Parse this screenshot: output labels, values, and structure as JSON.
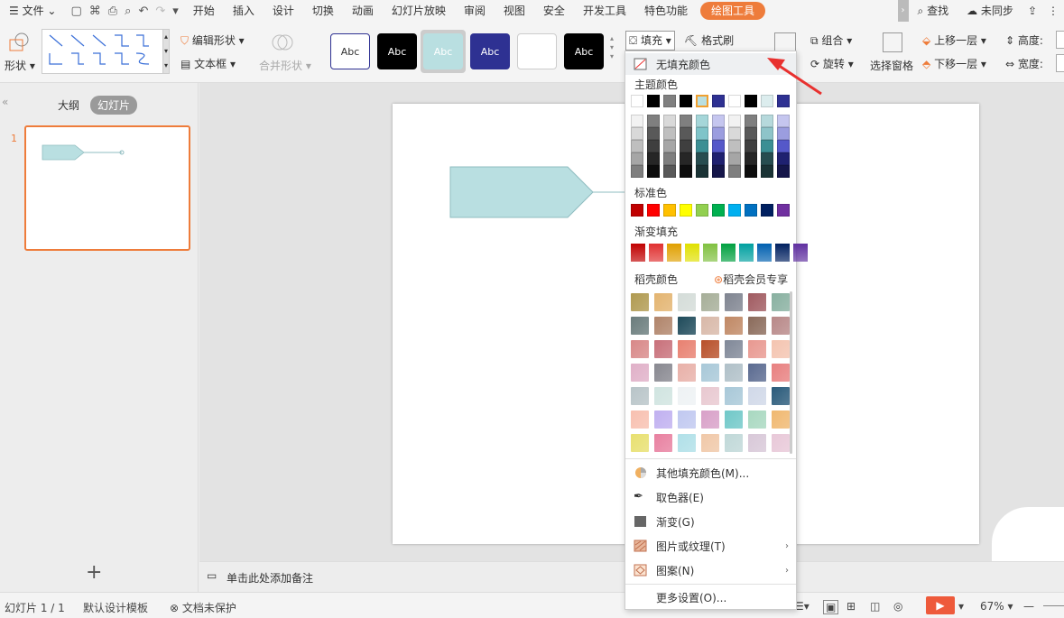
{
  "menubar": {
    "file": "文件",
    "tabs": [
      "开始",
      "插入",
      "设计",
      "切换",
      "动画",
      "幻灯片放映",
      "审阅",
      "视图",
      "安全",
      "开发工具",
      "特色功能"
    ],
    "active_tab": "绘图工具",
    "search": "查找",
    "sync": "未同步"
  },
  "ribbon": {
    "shape": "形状",
    "edit_shape": "编辑形状",
    "text_box": "文本框",
    "merge_shape": "合并形状",
    "style_label": "Abc",
    "fill": "填充",
    "format_painter": "格式刷",
    "group": "组合",
    "rotate": "旋转",
    "selection_pane": "选择窗格",
    "bring_forward": "上移一层",
    "send_backward": "下移一层",
    "height": "高度:",
    "width": "宽度:"
  },
  "panel": {
    "outline_tab": "大纲",
    "slides_tab": "幻灯片",
    "slide_number": "1",
    "add": "+"
  },
  "notes": {
    "placeholder": "单击此处添加备注"
  },
  "status": {
    "slide_count": "幻灯片 1 / 1",
    "template": "默认设计模板",
    "protection": "文档未保护",
    "zoom": "67%"
  },
  "dropdown": {
    "no_fill": "无填充颜色",
    "theme_colors": "主题颜色",
    "standard_colors": "标准色",
    "gradient_fill": "渐变填充",
    "docer_colors": "稻壳颜色",
    "member_exclusive": "稻壳会员专享",
    "more_colors": "其他填充颜色(M)...",
    "eyedropper": "取色器(E)",
    "gradient": "渐变(G)",
    "picture_texture": "图片或纹理(T)",
    "pattern": "图案(N)",
    "more_settings": "更多设置(O)..."
  },
  "colors": {
    "accent": "#ee7c3b",
    "shape_fill": "#b9dfe1",
    "theme_top": [
      "#ffffff",
      "#000000",
      "#808080",
      "#000000",
      "#b9dfe1",
      "#2e3192",
      "#ffffff",
      "#000000",
      "#dcedee",
      "#2e3192"
    ],
    "standard": [
      "#c00000",
      "#ff0000",
      "#ffc000",
      "#ffff00",
      "#92d050",
      "#00b050",
      "#00b0f0",
      "#0070c0",
      "#002060",
      "#7030a0"
    ],
    "gradient": [
      "#c00000",
      "#e03030",
      "#e0a000",
      "#e0e000",
      "#80c040",
      "#00a040",
      "#00a0a0",
      "#0060b0",
      "#002060",
      "#6030a0"
    ]
  }
}
